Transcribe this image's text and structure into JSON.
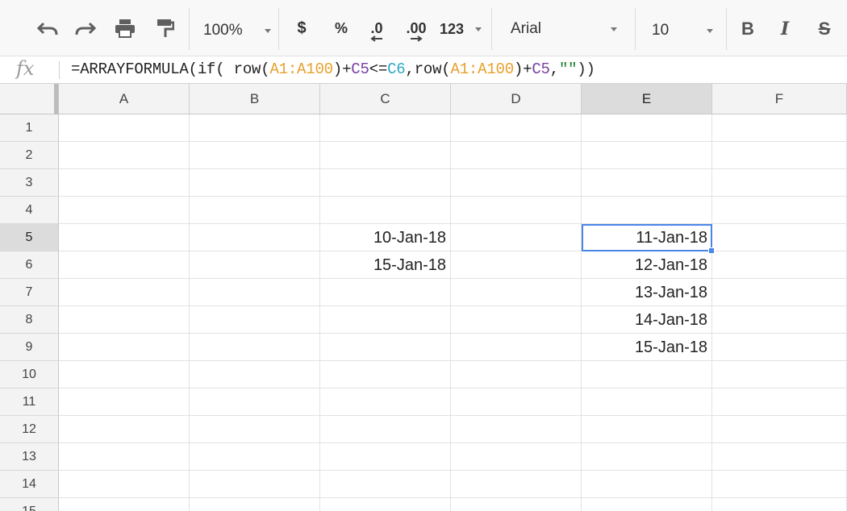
{
  "toolbar": {
    "zoom": "100%",
    "currency": "$",
    "percent": "%",
    "decrease_decimal": ".0",
    "increase_decimal": ".00",
    "more_formats": "123",
    "font_family": "Arial",
    "font_size": "10",
    "bold": "B",
    "italic": "I",
    "strikethrough": "S"
  },
  "formula_bar": {
    "fx_label": "fx",
    "parts": [
      "=ARRAYFORMULA(if( row(",
      "A1:A100",
      ")+",
      "C5",
      "<=",
      "C6",
      ",row(",
      "A1:A100",
      ")+",
      "C5",
      ",",
      "\"\"",
      "))"
    ]
  },
  "grid": {
    "columns": [
      "A",
      "B",
      "C",
      "D",
      "E",
      "F"
    ],
    "active_column": "E",
    "rows": [
      "1",
      "2",
      "3",
      "4",
      "5",
      "6",
      "7",
      "8",
      "9",
      "10",
      "11",
      "12",
      "13",
      "14",
      "15"
    ],
    "active_row": "5",
    "selected_cell": "E5",
    "cells": {
      "C5": "10-Jan-18",
      "C6": "15-Jan-18",
      "E5": "11-Jan-18",
      "E6": "12-Jan-18",
      "E7": "13-Jan-18",
      "E8": "14-Jan-18",
      "E9": "15-Jan-18"
    }
  },
  "colors": {
    "selection": "#4a86e8",
    "range_ref": "#e8a02a",
    "c5_ref": "#7b3fa6",
    "c6_ref": "#2ea8c4",
    "string_literal": "#1a7f2e"
  }
}
